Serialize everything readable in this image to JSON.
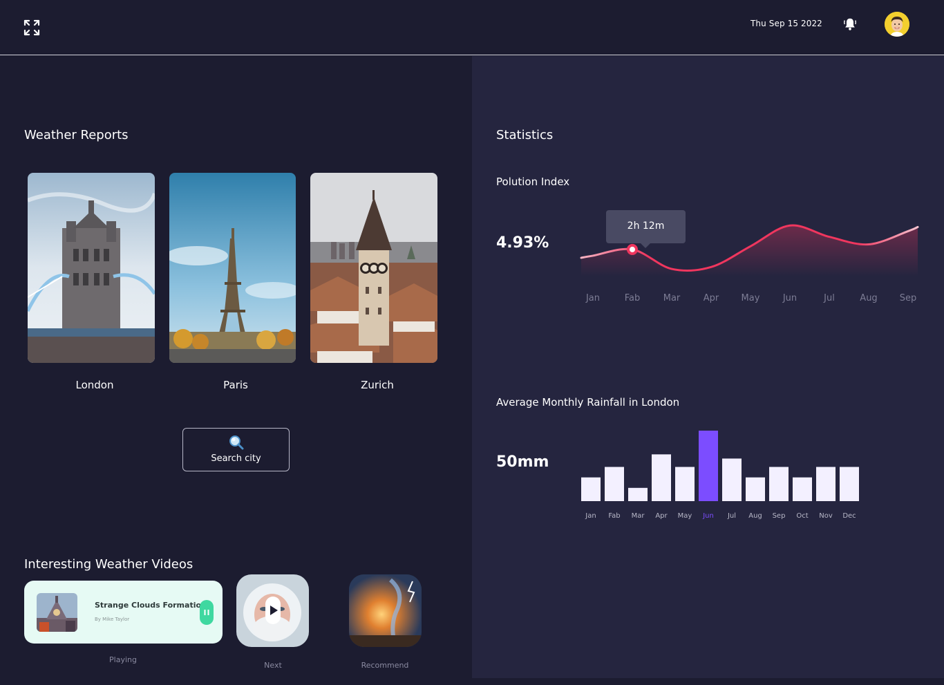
{
  "header": {
    "date": "Thu Sep 15 2022",
    "icons": {
      "expand": "expand-icon",
      "notification": "bell-icon",
      "avatar": "avatar"
    }
  },
  "weather_reports": {
    "title": "Weather Reports",
    "cities": [
      {
        "name": "London"
      },
      {
        "name": "Paris"
      },
      {
        "name": "Zurich"
      }
    ],
    "search_label": "Search city"
  },
  "videos": {
    "title": "Interesting Weather Videos",
    "playing": {
      "title": "Strange Clouds Formation",
      "author": "By Mike Taylor",
      "caption": "Playing"
    },
    "next_caption": "Next",
    "recommend_caption": "Recommend"
  },
  "statistics": {
    "title": "Statistics",
    "pollution": {
      "label": "Polution Index",
      "value": "4.93%",
      "tooltip": "2h 12m"
    },
    "rainfall": {
      "label": "Average Monthly Rainfall in London",
      "value": "50mm"
    }
  },
  "colors": {
    "background": "#1c1c30",
    "panel": "#25253f",
    "line": "#f0365e",
    "bar": "#f3f0ff",
    "bar_highlight": "#7c4dff",
    "card": "#e6faf4",
    "accent_green": "#3fd8a0"
  },
  "chart_data": [
    {
      "type": "line",
      "title": "Polution Index",
      "categories": [
        "Jan",
        "Fab",
        "Mar",
        "Apr",
        "May",
        "Jun",
        "Jul",
        "Aug",
        "Sep"
      ],
      "values": [
        4.6,
        4.93,
        3.9,
        4.0,
        5.1,
        6.2,
        5.6,
        5.2,
        5.9
      ],
      "highlight_index": 1,
      "grid": false
    },
    {
      "type": "bar",
      "title": "Average Monthly Rainfall in London",
      "categories": [
        "Jan",
        "Fab",
        "Mar",
        "Apr",
        "May",
        "Jun",
        "Jul",
        "Aug",
        "Sep",
        "Oct",
        "Nov",
        "Dec"
      ],
      "values": [
        34,
        49,
        19,
        67,
        49,
        101,
        61,
        34,
        49,
        34,
        49,
        49
      ],
      "highlight_index": 5,
      "grid": false
    }
  ]
}
